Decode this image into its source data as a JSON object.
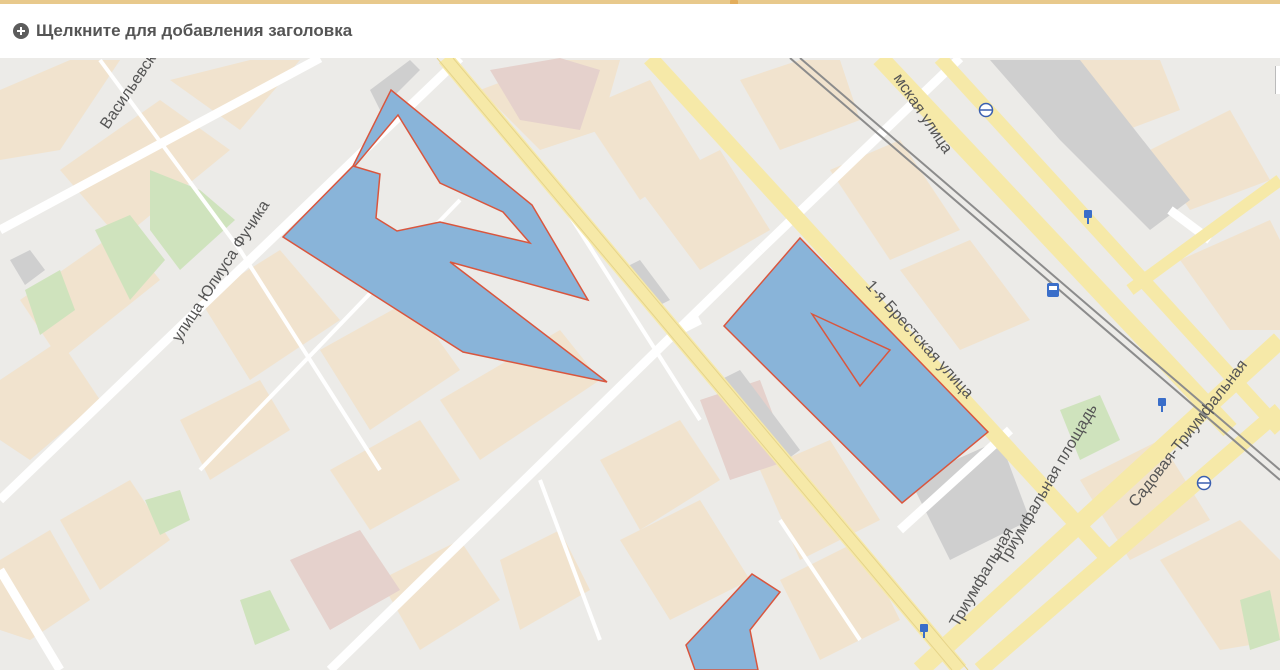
{
  "header": {
    "add_title_label": "Щелкните для добавления заголовка"
  },
  "map": {
    "streets": {
      "vasilyevskaya": "Васильевск",
      "yuliusa_fuchika": "улица Юлиуса Фучика",
      "tverskaya_yamskaya": "мская улица",
      "brestskaya": "1-я Брестская улица",
      "triumfalnaya_square": "Триумфальная площадь",
      "triumfalnaya_street": "Триумфальная",
      "sadovaya": "Садовая-Триумфальная"
    },
    "colors": {
      "background": "#ecebe8",
      "building": "#f1e3ce",
      "major_road": "#f6e9a8",
      "minor_road": "#ffffff",
      "park": "#cfe3bd",
      "highlight_fill": "#89b4d9",
      "highlight_stroke": "#d9563e",
      "header_accent": "#e8c98c"
    },
    "icons": [
      "metro-icon",
      "tram-icon",
      "bus-stop-icon"
    ]
  }
}
